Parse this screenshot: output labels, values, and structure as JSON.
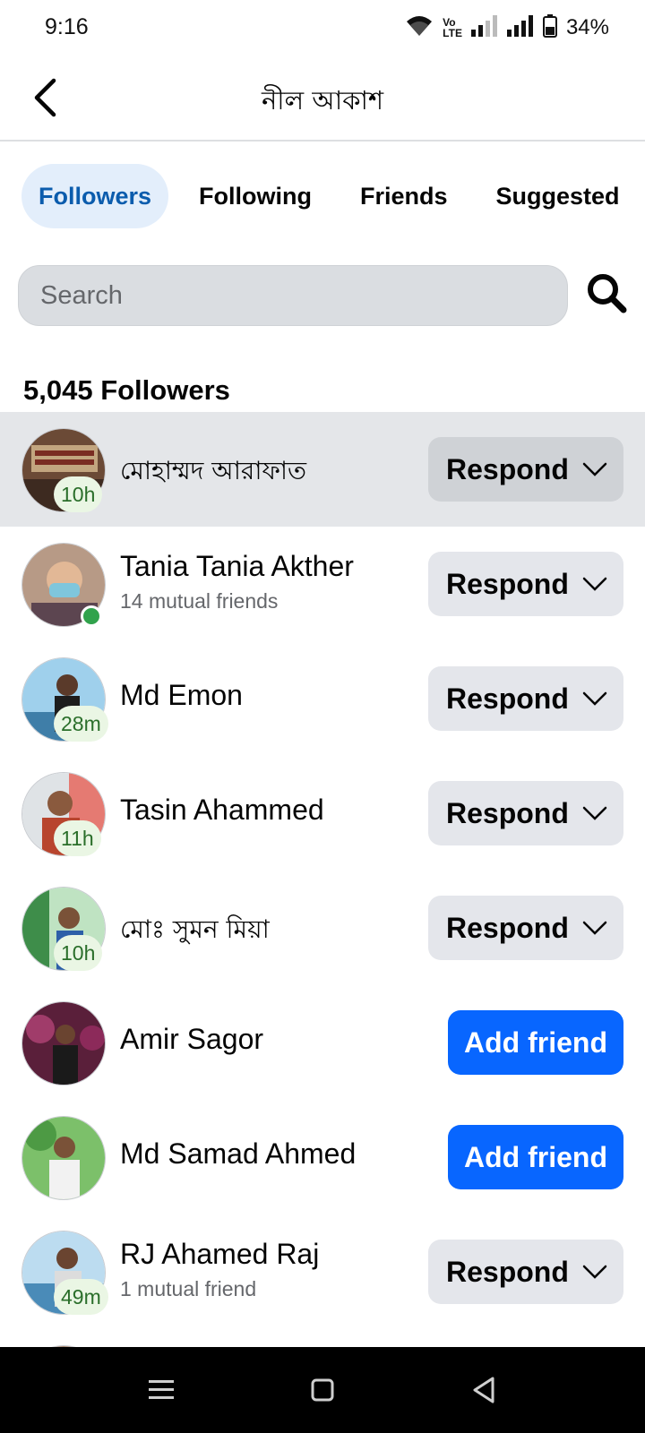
{
  "status_bar": {
    "time": "9:16",
    "battery": "34%",
    "icons": [
      "wifi-icon",
      "volte-icon",
      "signal-icon",
      "signal-icon",
      "battery-icon"
    ]
  },
  "header": {
    "title": "নীল আকাশ",
    "back_icon": "back-arrow-icon"
  },
  "tabs": [
    {
      "label": "Followers",
      "active": true
    },
    {
      "label": "Following",
      "active": false
    },
    {
      "label": "Friends",
      "active": false
    },
    {
      "label": "Suggested",
      "active": false
    }
  ],
  "search": {
    "placeholder": "Search",
    "value": "",
    "icon": "search-icon"
  },
  "followers_count": "5,045 Followers",
  "people": [
    {
      "name": "মোহাম্মদ আরাফাত",
      "subtitle": "",
      "badge": "10h",
      "online": false,
      "action": "Respond",
      "highlight": true
    },
    {
      "name": "Tania Tania Akther",
      "subtitle": "14 mutual friends",
      "badge": "",
      "online": true,
      "action": "Respond",
      "highlight": false
    },
    {
      "name": "Md Emon",
      "subtitle": "",
      "badge": "28m",
      "online": false,
      "action": "Respond",
      "highlight": false
    },
    {
      "name": "Tasin Ahammed",
      "subtitle": "",
      "badge": "11h",
      "online": false,
      "action": "Respond",
      "highlight": false
    },
    {
      "name": "মোঃ সুমন মিয়া",
      "subtitle": "",
      "badge": "10h",
      "online": false,
      "action": "Respond",
      "highlight": false
    },
    {
      "name": "Amir Sagor",
      "subtitle": "",
      "badge": "",
      "online": false,
      "action": "Add friend",
      "highlight": false
    },
    {
      "name": "Md Samad Ahmed",
      "subtitle": "",
      "badge": "",
      "online": false,
      "action": "Add friend",
      "highlight": false
    },
    {
      "name": "RJ Ahamed Raj",
      "subtitle": "1 mutual friend",
      "badge": "49m",
      "online": false,
      "action": "Respond",
      "highlight": false
    }
  ],
  "colors": {
    "accent": "#0866ff",
    "active_tab_bg": "#e3eefb",
    "active_tab_text": "#0b5cad",
    "button_gray": "#e4e6eb",
    "online": "#31a24c"
  },
  "nav_bar": {
    "icons": [
      "menu-icon",
      "home-square-icon",
      "back-triangle-icon"
    ]
  }
}
